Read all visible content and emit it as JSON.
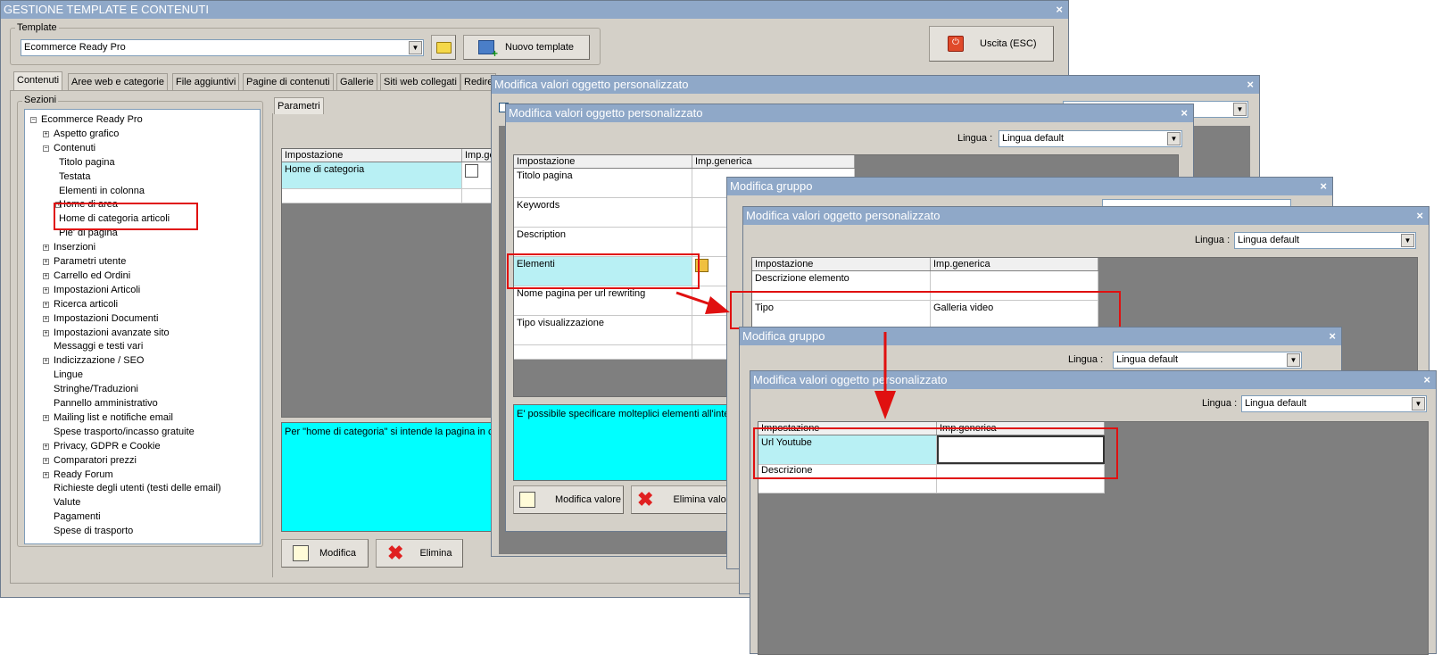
{
  "main": {
    "title": "GESTIONE TEMPLATE E CONTENUTI",
    "close": "×",
    "template_group": "Template",
    "template_value": "Ecommerce Ready Pro",
    "new_template": "Nuovo template",
    "exit": "Uscita (ESC)",
    "tabs": [
      "Contenuti",
      "Aree web e categorie",
      "File aggiuntivi",
      "Pagine di contenuti",
      "Gallerie",
      "Siti web collegati",
      "Redire"
    ],
    "sections_label": "Sezioni",
    "parametri_tab": "Parametri",
    "grid_headers": [
      "Impostazione",
      "Imp.generica"
    ],
    "grid_row": "Home di categoria",
    "description": "Per \"home di categoria\" si intende la pagina in cu",
    "modify": "Modifica",
    "delete": "Elimina"
  },
  "tree": [
    {
      "label": "Ecommerce Ready Pro",
      "level": 0,
      "exp": "minus"
    },
    {
      "label": "Aspetto grafico",
      "level": 1,
      "exp": "plus"
    },
    {
      "label": "Contenuti",
      "level": 1,
      "exp": "minus"
    },
    {
      "label": "Titolo pagina",
      "level": 2,
      "exp": ""
    },
    {
      "label": "Testata",
      "level": 2,
      "exp": ""
    },
    {
      "label": "Elementi in colonna",
      "level": 2,
      "exp": ""
    },
    {
      "label": "Home di area",
      "level": 2,
      "exp": "plus"
    },
    {
      "label": "Home di categoria articoli",
      "level": 2,
      "exp": ""
    },
    {
      "label": "Pie' di pagina",
      "level": 2,
      "exp": ""
    },
    {
      "label": "Inserzioni",
      "level": 1,
      "exp": "plus"
    },
    {
      "label": "Parametri utente",
      "level": 1,
      "exp": "plus"
    },
    {
      "label": "Carrello ed Ordini",
      "level": 1,
      "exp": "plus"
    },
    {
      "label": "Impostazioni Articoli",
      "level": 1,
      "exp": "plus"
    },
    {
      "label": "Ricerca articoli",
      "level": 1,
      "exp": "plus"
    },
    {
      "label": "Impostazioni Documenti",
      "level": 1,
      "exp": "plus"
    },
    {
      "label": "Impostazioni avanzate sito",
      "level": 1,
      "exp": "plus"
    },
    {
      "label": "Messaggi e testi vari",
      "level": 1,
      "exp": ""
    },
    {
      "label": "Indicizzazione / SEO",
      "level": 1,
      "exp": "plus"
    },
    {
      "label": "Lingue",
      "level": 1,
      "exp": ""
    },
    {
      "label": "Stringhe/Traduzioni",
      "level": 1,
      "exp": ""
    },
    {
      "label": "Pannello amministrativo",
      "level": 1,
      "exp": ""
    },
    {
      "label": "Mailing list e notifiche email",
      "level": 1,
      "exp": "plus"
    },
    {
      "label": "Spese trasporto/incasso gratuite",
      "level": 1,
      "exp": ""
    },
    {
      "label": "Privacy, GDPR e Cookie",
      "level": 1,
      "exp": "plus"
    },
    {
      "label": "Comparatori prezzi",
      "level": 1,
      "exp": "plus"
    },
    {
      "label": "Ready Forum",
      "level": 1,
      "exp": "plus"
    },
    {
      "label": "Richieste degli utenti (testi delle email)",
      "level": 1,
      "exp": ""
    },
    {
      "label": "Valute",
      "level": 1,
      "exp": ""
    },
    {
      "label": "Pagamenti",
      "level": 1,
      "exp": ""
    },
    {
      "label": "Spese di trasporto",
      "level": 1,
      "exp": ""
    }
  ],
  "d1": {
    "title": "Modifica valori oggetto personalizzato",
    "close": "×"
  },
  "d2": {
    "title": "Modifica valori oggetto personalizzato",
    "close": "×",
    "lingua_label": "Lingua :",
    "lingua_value": "Lingua default",
    "headers": [
      "Impostazione",
      "Imp.generica"
    ],
    "rows": [
      "Titolo pagina",
      "Keywords",
      "Description",
      "Elementi",
      "Nome pagina per url rewriting",
      "Tipo visualizzazione"
    ],
    "description": "E' possibile specificare molteplici elementi all'interno",
    "modify": "Modifica valore",
    "delete": "Elimina valor"
  },
  "d3": {
    "title": "Modifica gruppo",
    "close": "×"
  },
  "d4": {
    "title": "Modifica valori oggetto personalizzato",
    "close": "×",
    "lingua_label": "Lingua :",
    "lingua_value": "Lingua default",
    "headers": [
      "Impostazione",
      "Imp.generica"
    ],
    "rows": [
      {
        "label": "Descrizione elemento",
        "value": ""
      },
      {
        "label": "Tipo",
        "value": "Galleria video"
      }
    ]
  },
  "d5": {
    "title": "Modifica gruppo",
    "close": "×",
    "lingua_label": "Lingua :",
    "lingua_value": "Lingua default"
  },
  "d6": {
    "title": "Modifica valori oggetto personalizzato",
    "close": "×",
    "lingua_label": "Lingua :",
    "lingua_value": "Lingua default",
    "headers": [
      "Impostazione",
      "Imp.generica"
    ],
    "rows": [
      "Url Youtube",
      "Descrizione"
    ]
  },
  "colors": {
    "titlebar": "#8fa8c8",
    "selection": "#b8f0f4",
    "description_bg": "#00ffff",
    "annotation": "#e01010"
  }
}
